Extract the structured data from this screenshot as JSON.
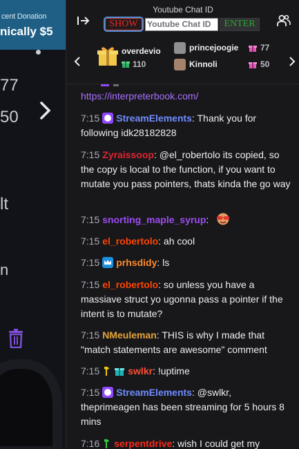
{
  "stream": {
    "banner_line1": "cent Donation",
    "banner_line2": "nically $5",
    "side_text": [
      "77",
      "50",
      "lt",
      "n"
    ]
  },
  "header": {
    "title": "Youtube Chat ID",
    "show_label": "SHOW",
    "input_placeholder": "Youtube Chat ID",
    "enter_label": "ENTER"
  },
  "leaderboard": {
    "top": {
      "name": "overdevio",
      "count": "110"
    },
    "rows": [
      {
        "name": "princejoogie",
        "count": "77"
      },
      {
        "name": "Kinnoli",
        "count": "50"
      }
    ]
  },
  "messages": [
    {
      "time": "",
      "user": "",
      "text": "https://interpreterbook.com/"
    },
    {
      "time": "7:15",
      "user": "StreamElements",
      "color": "#6f8cff",
      "text": ": Thank you for following idk28182828"
    },
    {
      "time": "7:15",
      "user": "Zyraissoop",
      "color": "#e0242f",
      "text": ": @el_robertolo its copied, so the copy is local to the function, if you want to mutate you pass pointers, thats kinda the go way"
    },
    {
      "time": "7:15",
      "user": "snorting_maple_syrup",
      "color": "#9d4cf0",
      "text": ": "
    },
    {
      "time": "7:15",
      "user": "el_robertolo",
      "color": "#ff4500",
      "text": ": ah cool"
    },
    {
      "time": "7:15",
      "user": "prhsdidy",
      "color": "#ff8a2a",
      "text": ": ls"
    },
    {
      "time": "7:15",
      "user": "el_robertolo",
      "color": "#ff4500",
      "text": ": so unless you have a massiave struct yo ugonna pass a pointer if the intent is to mutate?"
    },
    {
      "time": "7:15",
      "user": "NMeuleman",
      "color": "#e6a53a",
      "text": ": THIS is why I made that \"match statements are awesome\" comment"
    },
    {
      "time": "7:15",
      "user": "swlkr",
      "color": "#ff4f2f",
      "text": ": !uptime"
    },
    {
      "time": "7:15",
      "user": "StreamElements",
      "color": "#6f8cff",
      "text": ": @swlkr, theprimeagen has been streaming for 5 hours 8 mins"
    },
    {
      "time": "7:16",
      "user": "serpentdrive",
      "color": "#ff2a1a",
      "text": ": wish I could get my"
    }
  ],
  "colors": {
    "chat_bg": "#18181b",
    "twitch_purple": "#9147ff",
    "show_red": "#e22b2b",
    "enter_green": "#2fa52f"
  },
  "icons": [
    "collapse-chat-icon",
    "users-icon",
    "chevron-left-icon",
    "chevron-right-icon",
    "gift-icon",
    "trash-icon",
    "verified-icon",
    "crown-icon",
    "pickaxe-icon",
    "sunglasses-emote-icon"
  ]
}
